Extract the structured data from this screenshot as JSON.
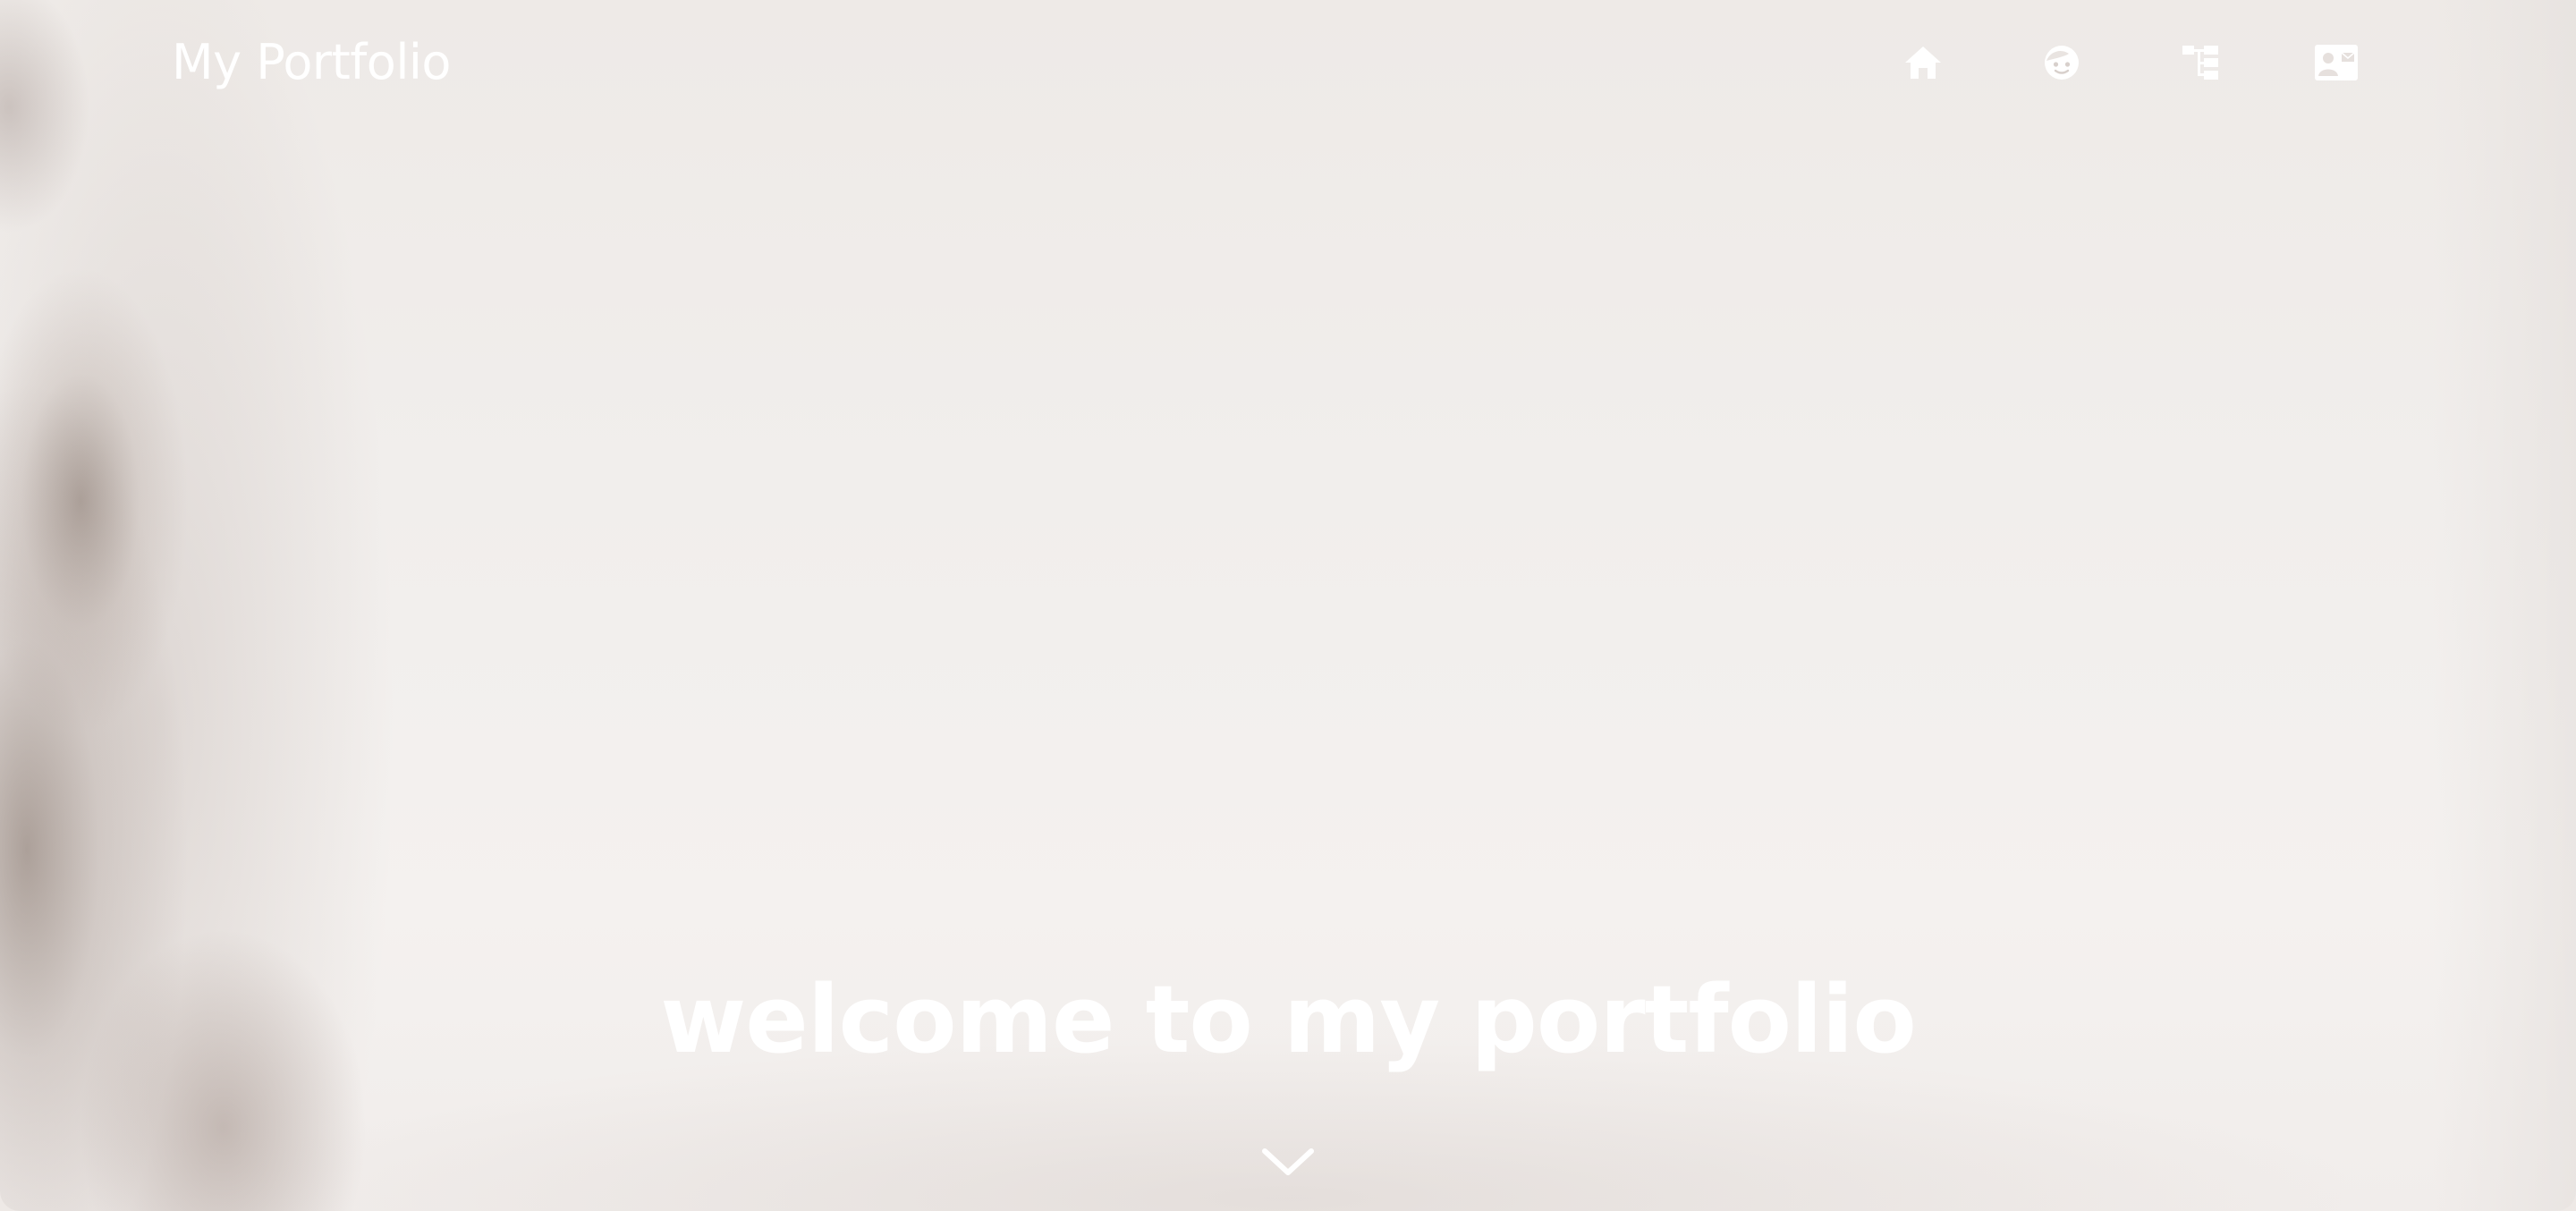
{
  "navbar": {
    "brand": "My Portfolio",
    "links": [
      {
        "name": "home",
        "icon": "home-icon"
      },
      {
        "name": "about",
        "icon": "face-icon"
      },
      {
        "name": "skills",
        "icon": "sitemap-icon"
      },
      {
        "name": "contact",
        "icon": "contact-card-icon"
      }
    ]
  },
  "hero": {
    "title": "welcome to my portfolio",
    "scroll_icon": "chevron-down-icon"
  },
  "colors": {
    "text": "#ffffff",
    "background": "#f1eeec"
  }
}
